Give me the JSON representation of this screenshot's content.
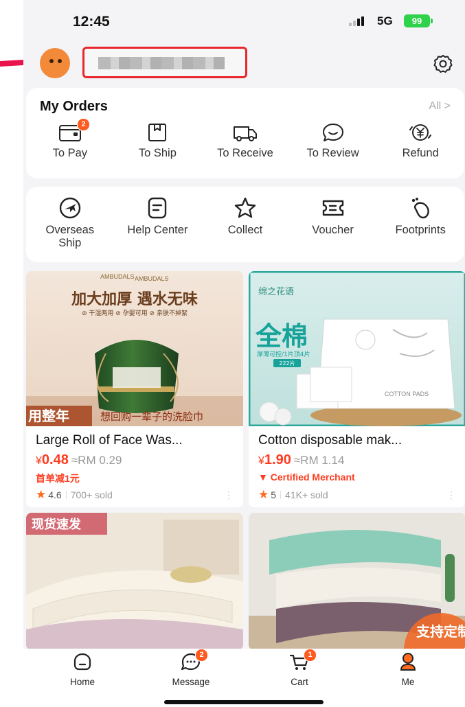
{
  "status": {
    "time": "12:45",
    "network": "5G",
    "battery": "99"
  },
  "profile": {
    "username_redacted": "████████"
  },
  "orders": {
    "title": "My Orders",
    "all_label": "All  >",
    "items": [
      {
        "label": "To Pay",
        "icon": "wallet-icon",
        "badge": "2"
      },
      {
        "label": "To Ship",
        "icon": "package-icon"
      },
      {
        "label": "To Receive",
        "icon": "truck-icon"
      },
      {
        "label": "To Review",
        "icon": "chat-bubble-icon"
      },
      {
        "label": "Refund",
        "icon": "refund-yen-icon"
      }
    ]
  },
  "services": {
    "items": [
      {
        "label": "Overseas Ship",
        "icon": "plane-icon"
      },
      {
        "label": "Help Center",
        "icon": "document-icon"
      },
      {
        "label": "Collect",
        "icon": "star-icon"
      },
      {
        "label": "Voucher",
        "icon": "ticket-icon"
      },
      {
        "label": "Footprints",
        "icon": "footprints-icon"
      }
    ]
  },
  "products": [
    {
      "title": "Large Roll of Face Was...",
      "price_symbol": "¥",
      "price": "0.48",
      "rm": "≈RM 0.29",
      "tag": "首单减1元",
      "rating": "4.6",
      "sold": "700+ sold",
      "img_brand": "AMBUDALS",
      "img_brand_small": "AMBUDALS",
      "img_headline": "加大加厚  遇水无味",
      "img_subline": "⊘ 干湿两用   ⊘ 孕婴可用   ⊘ 亲肤不掉絮",
      "img_banner_a": "用整年",
      "img_banner_b": "想回购一辈子的洗脸巾"
    },
    {
      "title": "Cotton disposable mak...",
      "price_symbol": "¥",
      "price": "1.90",
      "rm": "≈RM 1.14",
      "tag": "Certified Merchant",
      "rating": "5",
      "sold": "41K+ sold",
      "img_brand": "绵之花语",
      "img_headline": "全棉",
      "img_subline": "厚薄可控/1片顶4片",
      "img_count": "222片",
      "img_pack": "COTTON PADS"
    },
    {
      "img_tag": "现货速发"
    },
    {
      "img_tag": "支持定制"
    }
  ],
  "tabbar": {
    "items": [
      {
        "label": "Home",
        "icon": "home-icon"
      },
      {
        "label": "Message",
        "icon": "message-icon",
        "badge": "2"
      },
      {
        "label": "Cart",
        "icon": "cart-icon",
        "badge": "1"
      },
      {
        "label": "Me",
        "icon": "person-icon"
      }
    ]
  },
  "colors": {
    "accent": "#ff5a1f",
    "price": "#ff3b1f",
    "highlight_box": "#e8262d",
    "battery": "#2fd24a"
  }
}
